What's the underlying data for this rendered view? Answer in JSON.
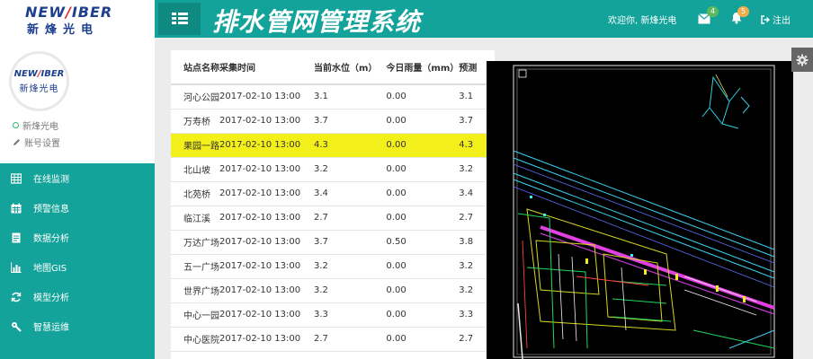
{
  "brand": {
    "logo_en_prefix": "NEW",
    "logo_en_slash": "/",
    "logo_en_suffix": "IBER",
    "logo_cn": "新烽光电"
  },
  "header": {
    "title": "排水管网管理系统",
    "welcome": "欢迎你, 新烽光电",
    "mail_count": "4",
    "alert_count": "5",
    "logout_label": "注出"
  },
  "profile": {
    "avatar_en_prefix": "NEW",
    "avatar_en_slash": "/",
    "avatar_en_suffix": "IBER",
    "avatar_cn": "新烽光电",
    "username": "新烽光电",
    "account_settings": "账号设置"
  },
  "nav": {
    "items": [
      {
        "label": "在线监测",
        "icon": "table-icon"
      },
      {
        "label": "预警信息",
        "icon": "calendar-icon"
      },
      {
        "label": "数据分析",
        "icon": "document-icon"
      },
      {
        "label": "地图GIS",
        "icon": "bar-chart-icon"
      },
      {
        "label": "模型分析",
        "icon": "refresh-icon"
      },
      {
        "label": "智慧运维",
        "icon": "wrench-icon"
      }
    ]
  },
  "table": {
    "headers": [
      "站点名称",
      "采集时间",
      "当前水位（m）",
      "今日雨量（mm）",
      "预测"
    ],
    "rows": [
      [
        "河心公园",
        "2017-02-10 13:00",
        "3.1",
        "0.00",
        "3.1"
      ],
      [
        "万寿桥",
        "2017-02-10 13:00",
        "3.7",
        "0.00",
        "3.7"
      ],
      [
        "果园一路",
        "2017-02-10 13:00",
        "4.3",
        "0.00",
        "4.3"
      ],
      [
        "北山坡",
        "2017-02-10 13:00",
        "3.2",
        "0.00",
        "3.2"
      ],
      [
        "北苑桥",
        "2017-02-10 13:00",
        "3.4",
        "0.00",
        "3.4"
      ],
      [
        "临江溪",
        "2017-02-10 13:00",
        "2.7",
        "0.00",
        "2.7"
      ],
      [
        "万达广场",
        "2017-02-10 13:00",
        "3.7",
        "0.50",
        "3.8"
      ],
      [
        "五一广场",
        "2017-02-10 13:00",
        "3.2",
        "0.00",
        "3.2"
      ],
      [
        "世界广场",
        "2017-02-10 13:00",
        "3.2",
        "0.00",
        "3.2"
      ],
      [
        "中心一园",
        "2017-02-10 13:00",
        "3.3",
        "0.00",
        "3.3"
      ],
      [
        "中心医院",
        "2017-02-10 13:00",
        "2.7",
        "0.00",
        "2.7"
      ]
    ],
    "highlighted_row": 2,
    "highlight_color": "#f2ef1a"
  },
  "colors": {
    "teal": "#14a39a",
    "teal_dark": "#0f8a82"
  }
}
